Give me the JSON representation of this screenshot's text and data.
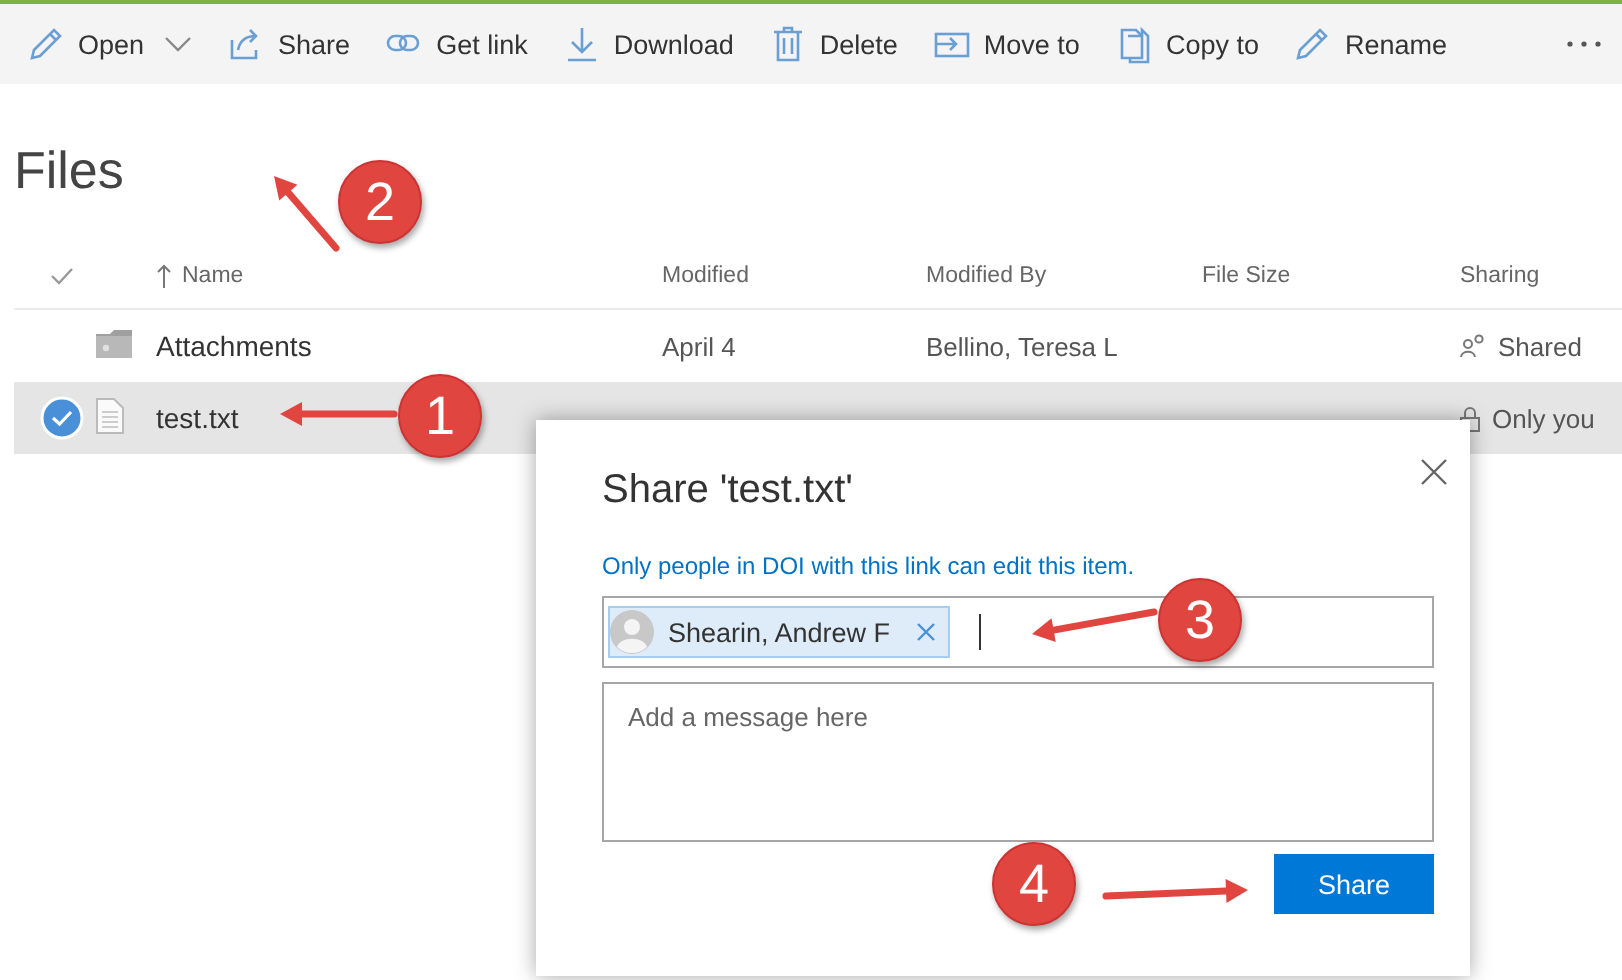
{
  "toolbar": {
    "items": [
      {
        "kind": "open",
        "label": "Open",
        "has_menu": true
      },
      {
        "kind": "share",
        "label": "Share",
        "has_menu": false
      },
      {
        "kind": "link",
        "label": "Get link",
        "has_menu": false
      },
      {
        "kind": "download",
        "label": "Download",
        "has_menu": false
      },
      {
        "kind": "delete",
        "label": "Delete",
        "has_menu": false
      },
      {
        "kind": "move",
        "label": "Move to",
        "has_menu": false
      },
      {
        "kind": "copy",
        "label": "Copy to",
        "has_menu": false
      },
      {
        "kind": "rename",
        "label": "Rename",
        "has_menu": false
      }
    ],
    "more": true
  },
  "files": {
    "title": "Files",
    "columns": [
      {
        "label": "Name",
        "sorted": true
      },
      {
        "label": "Modified",
        "sorted": false
      },
      {
        "label": "Modified By",
        "sorted": false
      },
      {
        "label": "File Size",
        "sorted": false
      },
      {
        "label": "Sharing",
        "sorted": false
      }
    ],
    "rows": [
      {
        "kind": "folder",
        "name": "Attachments",
        "modified": "April 4",
        "modified_by": "Bellino, Teresa L",
        "sharing": "Shared",
        "shared": true,
        "selected": false
      },
      {
        "kind": "file",
        "name": "test.txt",
        "sharing": "Only you",
        "shared": false,
        "selected": true
      }
    ]
  },
  "dialog": {
    "title": "Share 'test.txt'",
    "notice": "Only people in DOI with this link can edit this item.",
    "recipients": [
      {
        "name": "Shearin, Andrew F"
      }
    ],
    "message_placeholder": "Add a message here",
    "button": "Share"
  },
  "annotations": [
    {
      "number": "1"
    },
    {
      "number": "2"
    },
    {
      "number": "3"
    },
    {
      "number": "4"
    }
  ]
}
